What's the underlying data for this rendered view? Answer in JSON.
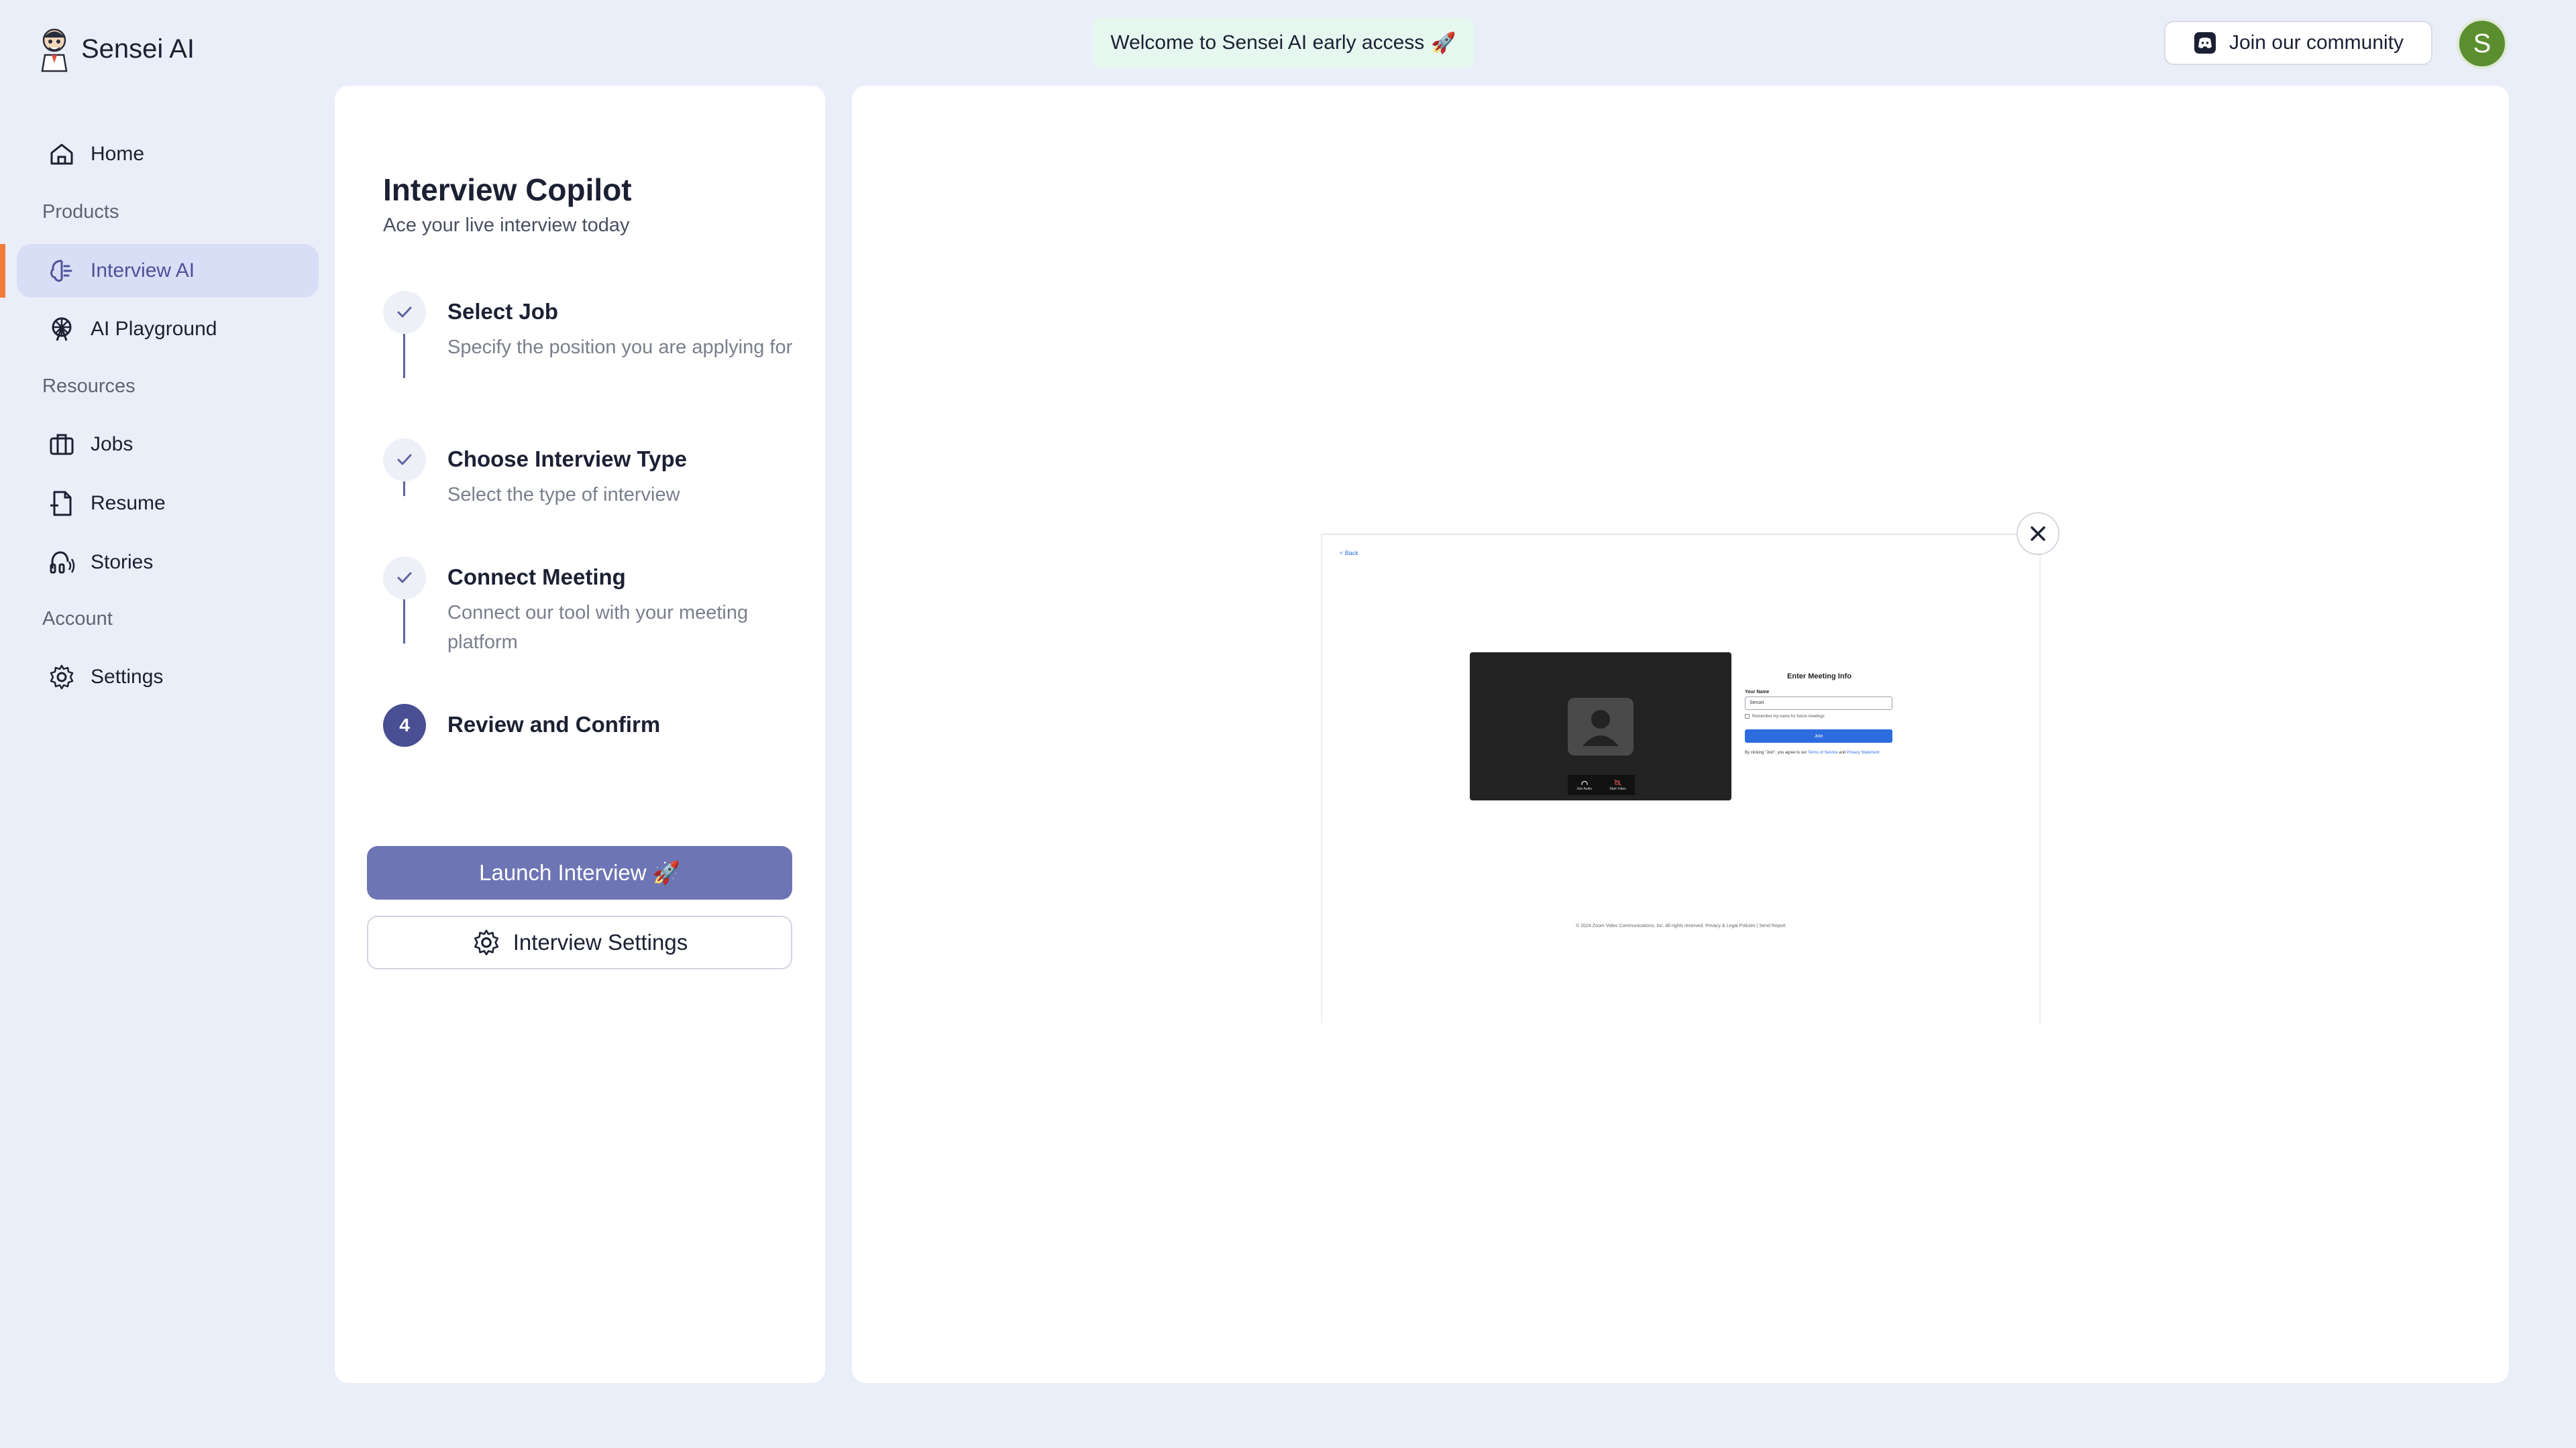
{
  "brand": {
    "name": "Sensei AI",
    "logo_icon": "sensei-mascot-icon"
  },
  "banner": {
    "text": "Welcome to Sensei AI early access",
    "emoji": "🚀"
  },
  "community": {
    "label": "Join our community",
    "icon": "discord-icon"
  },
  "user": {
    "avatar_initial": "S",
    "avatar_color": "#5b8e2f"
  },
  "sidebar": {
    "home": "Home",
    "section_products": "Products",
    "interview_ai": "Interview AI",
    "ai_playground": "AI Playground",
    "section_resources": "Resources",
    "jobs": "Jobs",
    "resume": "Resume",
    "stories": "Stories",
    "section_account": "Account",
    "settings": "Settings",
    "active_item": "Interview AI",
    "accent_color": "#f07c3c"
  },
  "copilot": {
    "title": "Interview Copilot",
    "subtitle": "Ace your live interview today",
    "steps": [
      {
        "title": "Select Job",
        "description": "Specify the position you are applying for",
        "state": "done"
      },
      {
        "title": "Choose Interview Type",
        "description": "Select the type of interview",
        "state": "done"
      },
      {
        "title": "Connect Meeting",
        "description": "Connect our tool with your meeting platform",
        "state": "done"
      },
      {
        "title": "Review and Confirm",
        "number": "4",
        "state": "current"
      }
    ],
    "launch_label": "Launch Interview 🚀",
    "settings_label": "Interview Settings"
  },
  "meeting_preview": {
    "back": "< Back",
    "heading": "Enter Meeting Info",
    "name_label": "Your Name",
    "name_value": "Sensei",
    "remember_label": "Remember my name for future meetings",
    "join_label": "Join",
    "audio_label": "Join Audio",
    "video_label": "Start Video",
    "terms_prefix": "By clicking \"Join\", you agree to our",
    "terms_link": "Terms of Service",
    "terms_and": "and",
    "privacy_link": "Privacy Statement",
    "footer": "© 2024 Zoom Video Communications, Inc. All rights reserved. Privacy & Legal Policies | Send Report"
  },
  "colors": {
    "background": "#eaeef8",
    "primary": "#6e75b5",
    "step_current": "#4a4f93",
    "banner_bg": "#e6f7ef"
  }
}
